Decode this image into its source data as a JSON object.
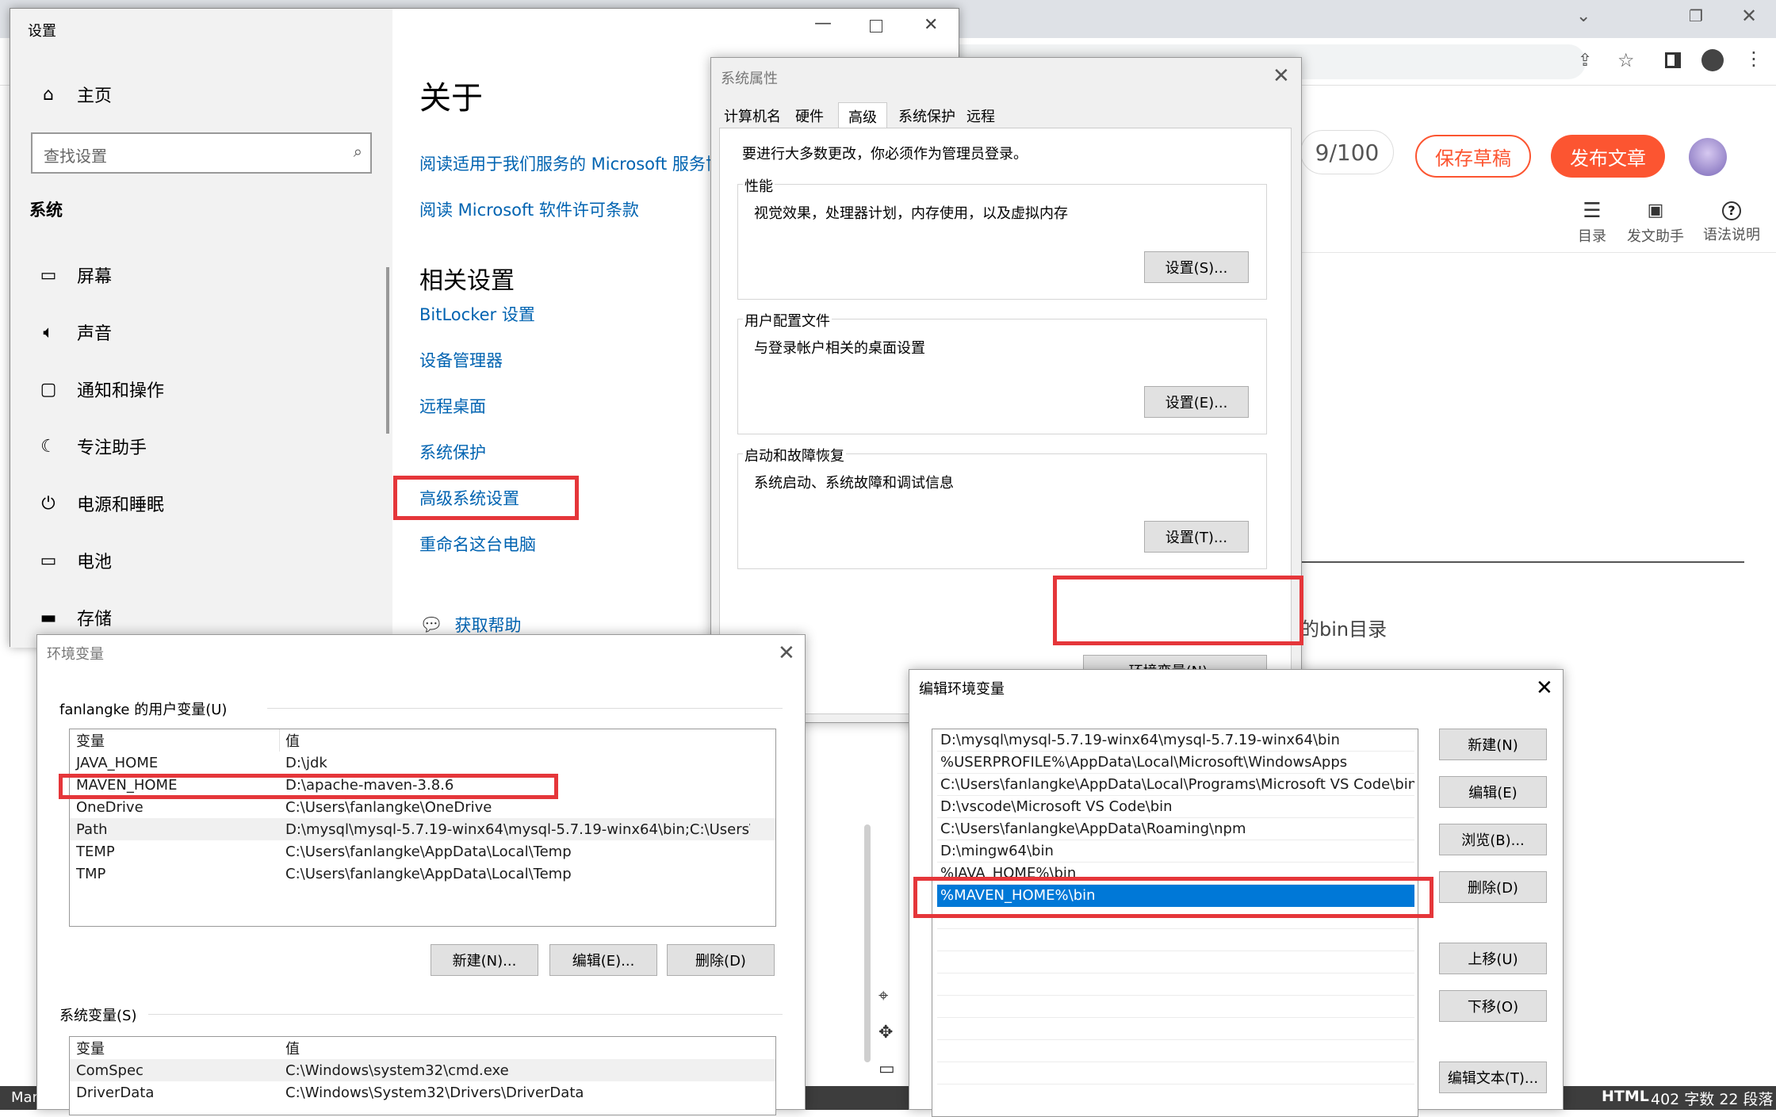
{
  "browser": {
    "counter": "9/100",
    "save_draft": "保存草稿",
    "publish": "发布文章",
    "tools": [
      {
        "icon": "list-icon",
        "label": "目录"
      },
      {
        "icon": "chart-icon",
        "label": "发文助手"
      },
      {
        "icon": "help-icon",
        "label": "语法说明"
      }
    ],
    "content_snippet": "的bin目录",
    "status_html": "HTML",
    "status_count": "402 字数 22 段落",
    "taskbar_left": "Mar",
    "colors": {
      "accent": "#fc5531"
    }
  },
  "settings": {
    "title": "设置",
    "home": "主页",
    "search_placeholder": "查找设置",
    "section": "系统",
    "nav": [
      {
        "icon": "monitor-icon",
        "label": "屏幕"
      },
      {
        "icon": "speaker-icon",
        "label": "声音"
      },
      {
        "icon": "notification-icon",
        "label": "通知和操作"
      },
      {
        "icon": "moon-icon",
        "label": "专注助手"
      },
      {
        "icon": "power-icon",
        "label": "电源和睡眠"
      },
      {
        "icon": "battery-icon",
        "label": "电池"
      },
      {
        "icon": "storage-icon",
        "label": "存储"
      }
    ],
    "about_title": "关于",
    "links_top": [
      "阅读适用于我们服务的 Microsoft 服务协",
      "阅读 Microsoft 软件许可条款"
    ],
    "related_title": "相关设置",
    "related_links": [
      "BitLocker 设置",
      "设备管理器",
      "远程桌面",
      "系统保护",
      "高级系统设置",
      "重命名这台电脑"
    ],
    "help": "获取帮助"
  },
  "sysprops": {
    "title": "系统属性",
    "tabs": [
      "计算机名",
      "硬件",
      "高级",
      "系统保护",
      "远程"
    ],
    "admin_note": "要进行大多数更改，你必须作为管理员登录。",
    "groups": [
      {
        "title": "性能",
        "desc": "视觉效果，处理器计划，内存使用，以及虚拟内存",
        "button": "设置(S)..."
      },
      {
        "title": "用户配置文件",
        "desc": "与登录帐户相关的桌面设置",
        "button": "设置(E)..."
      },
      {
        "title": "启动和故障恢复",
        "desc": "系统启动、系统故障和调试信息",
        "button": "设置(T)..."
      }
    ],
    "env_button": "环境变量(N)..."
  },
  "envvars": {
    "title": "环境变量",
    "user_section": "fanlangke 的用户变量(U)",
    "col_var": "变量",
    "col_val": "值",
    "user_vars": [
      {
        "name": "JAVA_HOME",
        "value": "D:\\jdk"
      },
      {
        "name": "MAVEN_HOME",
        "value": "D:\\apache-maven-3.8.6"
      },
      {
        "name": "OneDrive",
        "value": "C:\\Users\\fanlangke\\OneDrive"
      },
      {
        "name": "Path",
        "value": "D:\\mysql\\mysql-5.7.19-winx64\\mysql-5.7.19-winx64\\bin;C:\\Users\\..."
      },
      {
        "name": "TEMP",
        "value": "C:\\Users\\fanlangke\\AppData\\Local\\Temp"
      },
      {
        "name": "TMP",
        "value": "C:\\Users\\fanlangke\\AppData\\Local\\Temp"
      }
    ],
    "user_buttons": [
      "新建(N)...",
      "编辑(E)...",
      "删除(D)"
    ],
    "sys_section": "系统变量(S)",
    "sys_vars": [
      {
        "name": "ComSpec",
        "value": "C:\\Windows\\system32\\cmd.exe"
      },
      {
        "name": "DriverData",
        "value": "C:\\Windows\\System32\\Drivers\\DriverData"
      }
    ]
  },
  "editenv": {
    "title": "编辑环境变量",
    "paths": [
      "D:\\mysql\\mysql-5.7.19-winx64\\mysql-5.7.19-winx64\\bin",
      "%USERPROFILE%\\AppData\\Local\\Microsoft\\WindowsApps",
      "C:\\Users\\fanlangke\\AppData\\Local\\Programs\\Microsoft VS Code\\bin",
      "D:\\vscode\\Microsoft VS Code\\bin",
      "C:\\Users\\fanlangke\\AppData\\Roaming\\npm",
      "D:\\mingw64\\bin",
      "%JAVA_HOME%\\bin",
      "%MAVEN_HOME%\\bin"
    ],
    "buttons": [
      "新建(N)",
      "编辑(E)",
      "浏览(B)...",
      "删除(D)",
      "上移(U)",
      "下移(O)",
      "编辑文本(T)..."
    ]
  }
}
